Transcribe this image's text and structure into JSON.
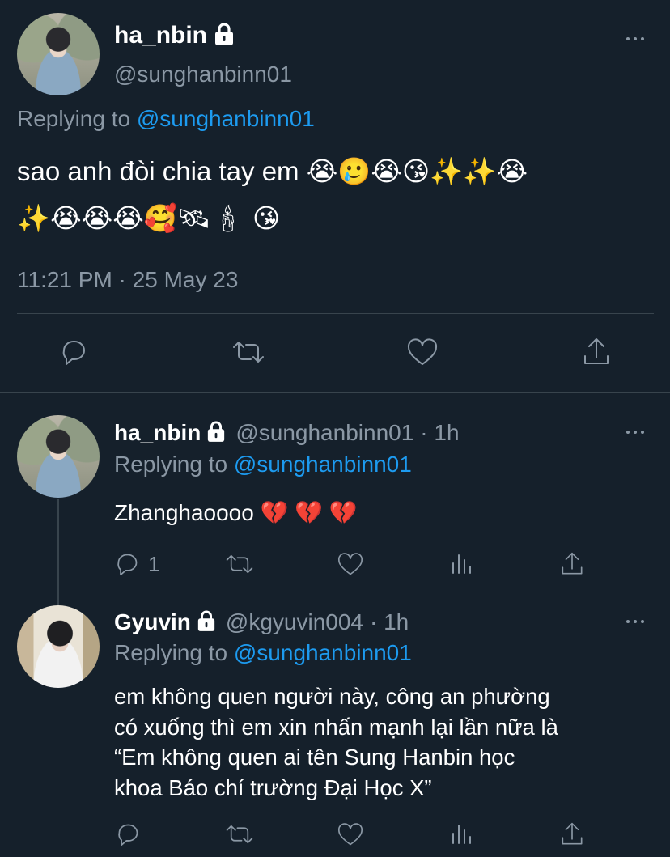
{
  "main_tweet": {
    "display_name": "ha_nbin",
    "handle": "@sunghanbinn01",
    "replying_prefix": "Replying to",
    "replying_handle": "@sunghanbinn01",
    "text_line1": "sao anh đòi chia tay em 😭🥲😭😘✨✨😭",
    "text_line2": "✨😭😭😭🥰🛰🕯 😘",
    "timestamp": "11:21 PM · 25 May 23"
  },
  "reply1": {
    "display_name": "ha_nbin",
    "handle": "@sunghanbinn01",
    "time": "· 1h",
    "replying_prefix": "Replying to",
    "replying_handle": "@sunghanbinn01",
    "text": "Zhanghaoooo 💔 💔 💔",
    "reply_count": "1"
  },
  "reply2": {
    "display_name": "Gyuvin",
    "handle": "@kgyuvin004",
    "time": "· 1h",
    "replying_prefix": "Replying to",
    "replying_handle": "@sunghanbinn01",
    "text_lines": [
      "em không quen người này, công an phường",
      "có xuống thì em xin nhấn mạnh lại lần nữa là",
      "“Em không quen ai tên Sung Hanbin học",
      "khoa Báo chí trường Đại Học X”"
    ]
  },
  "icons": {
    "reply": "reply-icon",
    "retweet": "retweet-icon",
    "like": "heart-icon",
    "share": "share-icon",
    "analytics": "analytics-icon",
    "more": "more-icon",
    "lock": "lock-icon"
  },
  "colors": {
    "background": "#15202b",
    "text": "#ffffff",
    "muted": "#8b98a5",
    "accent": "#1d9bf0",
    "divider": "#38444d"
  }
}
